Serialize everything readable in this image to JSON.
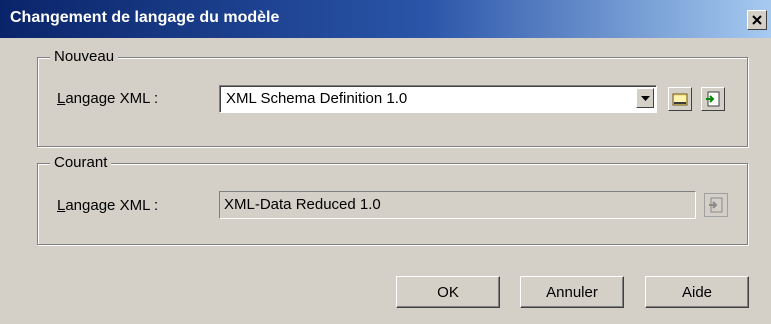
{
  "window": {
    "title": "Changement de langage du modèle",
    "close_icon": "close-icon"
  },
  "new_group": {
    "legend": "Nouveau",
    "label_prefix": "L",
    "label_rest": "angage XML :",
    "select_value": "XML Schema Definition 1.0",
    "icons": [
      "dropdown-arrow-icon",
      "folder-icon",
      "properties-icon"
    ]
  },
  "current_group": {
    "legend": "Courant",
    "label_prefix": "L",
    "label_rest": "angage XML :",
    "value": "XML-Data Reduced 1.0",
    "icons": [
      "properties-icon"
    ]
  },
  "buttons": {
    "ok": "OK",
    "cancel": "Annuler",
    "help": "Aide"
  }
}
